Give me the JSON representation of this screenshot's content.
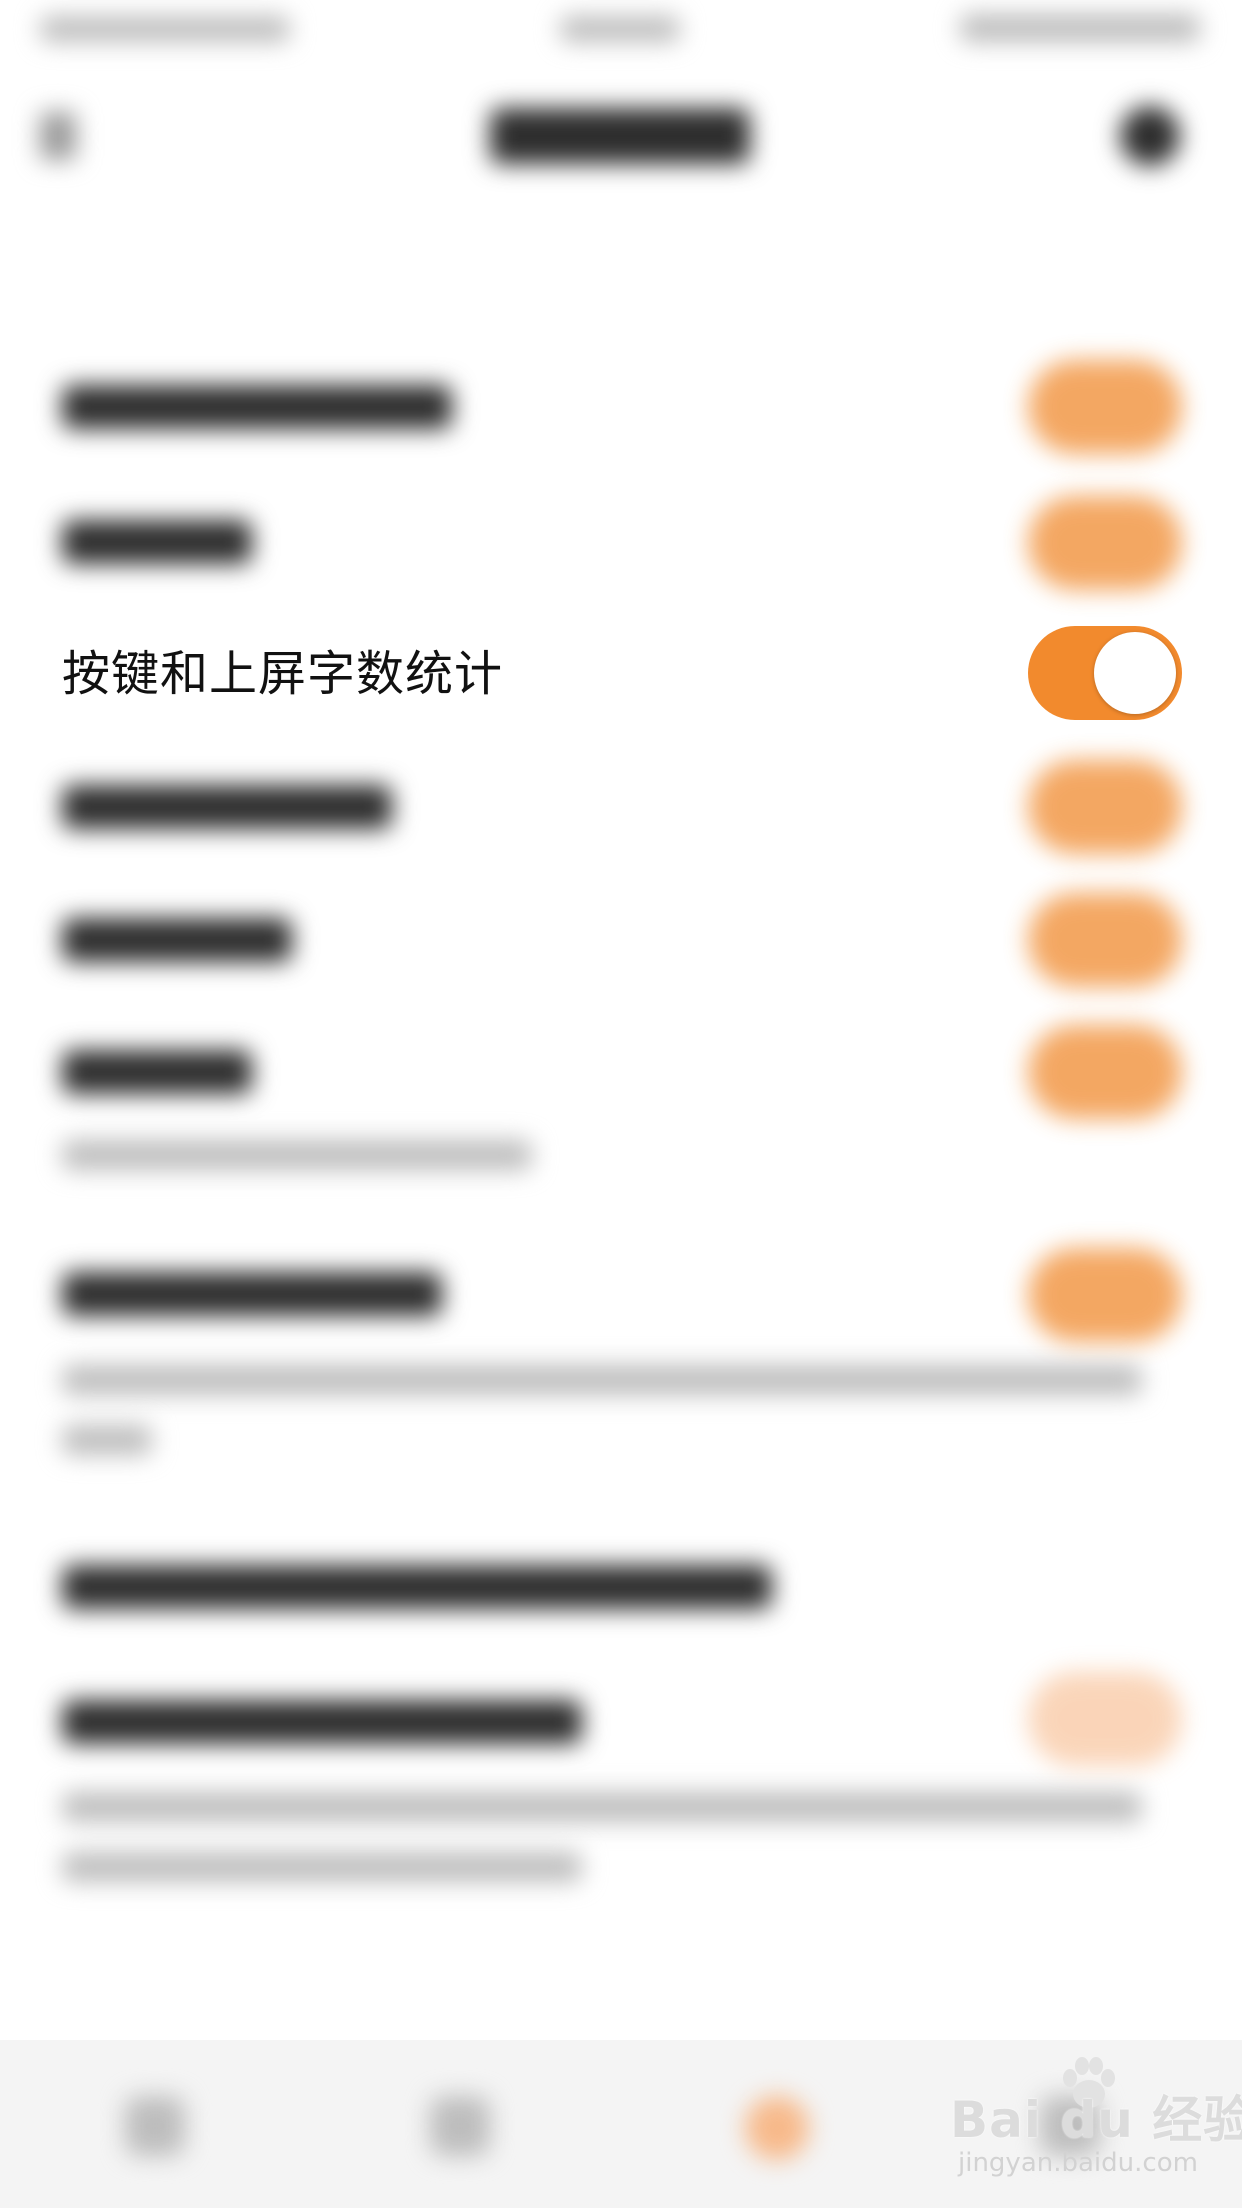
{
  "settings": {
    "visible_item": {
      "label": "按键和上屏字数统计",
      "toggle_on": true
    }
  },
  "colors": {
    "accent": "#f28a2d",
    "background": "#ffffff",
    "tab_bar": "#f4f4f4"
  },
  "watermark": {
    "logo": "Bai du 经验",
    "url": "jingyan.baidu.com"
  }
}
